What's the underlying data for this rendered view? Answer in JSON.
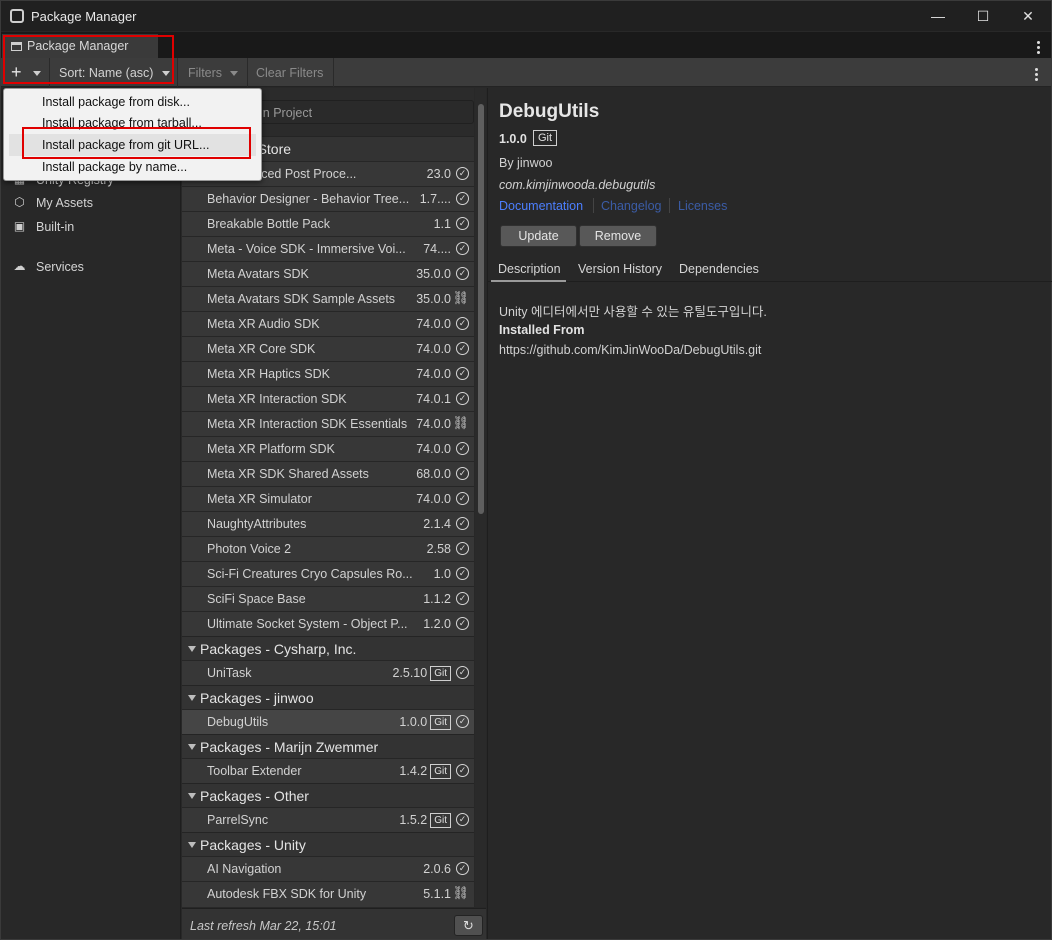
{
  "window": {
    "title": "Package Manager",
    "minimize": "—",
    "maximize": "☐",
    "close": "✕"
  },
  "tab": {
    "label": "Package Manager"
  },
  "toolbar": {
    "add": "+",
    "sort": "Sort: Name (asc)",
    "filters": "Filters",
    "clear_filters": "Clear Filters"
  },
  "search": {
    "placeholder": "in Project"
  },
  "add_menu": {
    "items": [
      "Install package from disk...",
      "Install package from tarball...",
      "Install package from git URL...",
      "Install package by name..."
    ]
  },
  "sidebar": {
    "items": [
      {
        "label": "Unity Registry",
        "icon": "grid-icon"
      },
      {
        "label": "My Assets",
        "icon": "cube-icon"
      },
      {
        "label": "Built-in",
        "icon": "puzzle-icon"
      },
      {
        "label": "Services",
        "icon": "cloud-icon"
      }
    ]
  },
  "groups": [
    {
      "title": "s - Asset Store",
      "rows": [
        {
          "name": "S - Advanced Post Proce...",
          "version": "23.0",
          "status": "check"
        },
        {
          "name": "Behavior Designer - Behavior Tree...",
          "version": "1.7....",
          "status": "check"
        },
        {
          "name": "Breakable Bottle Pack",
          "version": "1.1",
          "status": "check"
        },
        {
          "name": "Meta - Voice SDK - Immersive Voi...",
          "version": "74....",
          "status": "check"
        },
        {
          "name": "Meta Avatars SDK",
          "version": "35.0.0",
          "status": "check"
        },
        {
          "name": "Meta Avatars SDK Sample Assets",
          "version": "35.0.0",
          "status": "link"
        },
        {
          "name": "Meta XR Audio SDK",
          "version": "74.0.0",
          "status": "check"
        },
        {
          "name": "Meta XR Core SDK",
          "version": "74.0.0",
          "status": "check"
        },
        {
          "name": "Meta XR Haptics SDK",
          "version": "74.0.0",
          "status": "check"
        },
        {
          "name": "Meta XR Interaction SDK",
          "version": "74.0.1",
          "status": "check"
        },
        {
          "name": "Meta XR Interaction SDK Essentials",
          "version": "74.0.0",
          "status": "link"
        },
        {
          "name": "Meta XR Platform SDK",
          "version": "74.0.0",
          "status": "check"
        },
        {
          "name": "Meta XR SDK Shared Assets",
          "version": "68.0.0",
          "status": "check"
        },
        {
          "name": "Meta XR Simulator",
          "version": "74.0.0",
          "status": "check"
        },
        {
          "name": "NaughtyAttributes",
          "version": "2.1.4",
          "status": "check"
        },
        {
          "name": "Photon Voice 2",
          "version": "2.58",
          "status": "check"
        },
        {
          "name": "Sci-Fi Creatures Cryo Capsules Ro...",
          "version": "1.0",
          "status": "check"
        },
        {
          "name": "SciFi Space Base",
          "version": "1.1.2",
          "status": "check"
        },
        {
          "name": "Ultimate Socket System - Object P...",
          "version": "1.2.0",
          "status": "check"
        }
      ]
    },
    {
      "title": "Packages - Cysharp, Inc.",
      "rows": [
        {
          "name": "UniTask",
          "version": "2.5.10",
          "git": "Git",
          "status": "check"
        }
      ]
    },
    {
      "title": "Packages - jinwoo",
      "rows": [
        {
          "name": "DebugUtils",
          "version": "1.0.0",
          "git": "Git",
          "status": "check",
          "selected": true
        }
      ]
    },
    {
      "title": "Packages - Marijn Zwemmer",
      "rows": [
        {
          "name": "Toolbar Extender",
          "version": "1.4.2",
          "git": "Git",
          "status": "check"
        }
      ]
    },
    {
      "title": "Packages - Other",
      "rows": [
        {
          "name": "ParrelSync",
          "version": "1.5.2",
          "git": "Git",
          "status": "check"
        }
      ]
    },
    {
      "title": "Packages - Unity",
      "rows": [
        {
          "name": "AI Navigation",
          "version": "2.0.6",
          "status": "check"
        },
        {
          "name": "Autodesk FBX SDK for Unity",
          "version": "5.1.1",
          "status": "link"
        }
      ]
    }
  ],
  "footer": {
    "last_refresh": "Last refresh Mar 22, 15:01",
    "refresh_icon": "↻"
  },
  "detail": {
    "name": "DebugUtils",
    "version": "1.0.0",
    "git_badge": "Git",
    "author": "By jinwoo",
    "package_id": "com.kimjinwooda.debugutils",
    "links": [
      "Documentation",
      "Changelog",
      "Licenses"
    ],
    "buttons": {
      "update": "Update",
      "remove": "Remove"
    },
    "tabs": [
      "Description",
      "Version History",
      "Dependencies"
    ],
    "description": "Unity 에디터에서만 사용할 수 있는 유틸도구입니다.",
    "installed_from_label": "Installed From",
    "installed_from_url": "https://github.com/KimJinWooDa/DebugUtils.git"
  },
  "colors": {
    "accent_link": "#4c7fff",
    "highlight_box": "#e00000"
  }
}
